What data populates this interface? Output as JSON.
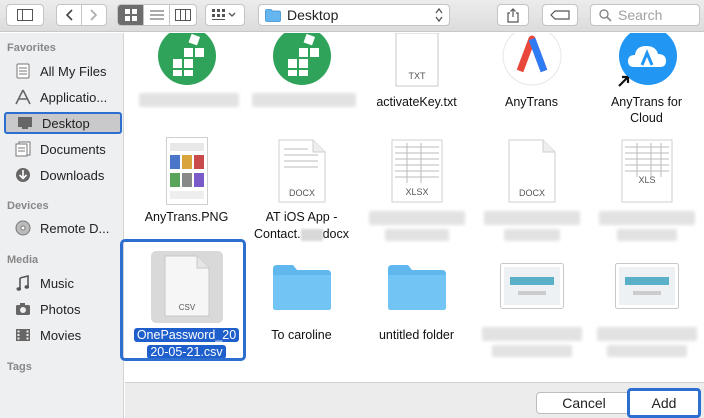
{
  "toolbar": {
    "location": "Desktop",
    "search_placeholder": "Search",
    "view_modes": [
      "icon-view",
      "list-view",
      "column-view"
    ],
    "active_view": "icon-view"
  },
  "sidebar": {
    "favorites_title": "Favorites",
    "favorites": [
      {
        "label": "All My Files",
        "icon": "all-files-icon"
      },
      {
        "label": "Applicatio...",
        "icon": "applications-icon"
      },
      {
        "label": "Desktop",
        "icon": "desktop-icon",
        "selected": true
      },
      {
        "label": "Documents",
        "icon": "documents-icon"
      },
      {
        "label": "Downloads",
        "icon": "downloads-icon"
      }
    ],
    "devices_title": "Devices",
    "devices": [
      {
        "label": "Remote D...",
        "icon": "remote-disc-icon"
      }
    ],
    "media_title": "Media",
    "media": [
      {
        "label": "Music",
        "icon": "music-icon"
      },
      {
        "label": "Photos",
        "icon": "photos-icon"
      },
      {
        "label": "Movies",
        "icon": "movies-icon"
      }
    ],
    "tags_title": "Tags"
  },
  "files": [
    {
      "name": "",
      "kind": "green-app"
    },
    {
      "name": "",
      "kind": "green-app"
    },
    {
      "name": "activateKey.txt",
      "kind": "txt",
      "badge": "TXT"
    },
    {
      "name": "AnyTrans",
      "kind": "anytrans-app"
    },
    {
      "name": "AnyTrans for Cloud",
      "name_line1": "AnyTrans for",
      "name_line2": "Cloud",
      "kind": "anytrans-cloud-alias"
    },
    {
      "name": "AnyTrans.PNG",
      "kind": "png"
    },
    {
      "name_line1": "AT iOS App -",
      "name_line2": "Contact.",
      "name_line2_end": "docx",
      "kind": "docx",
      "badge": "DOCX"
    },
    {
      "name": "",
      "kind": "xlsx",
      "badge": "XLSX"
    },
    {
      "name": "",
      "kind": "docx",
      "badge": "DOCX"
    },
    {
      "name": "",
      "kind": "xls",
      "badge": "XLS"
    },
    {
      "name_line1": "OnePassword_20",
      "name_line2": "20-05-21.csv",
      "kind": "csv",
      "badge": "CSV",
      "selected": true
    },
    {
      "name": "To caroline",
      "kind": "folder"
    },
    {
      "name": "untitled folder",
      "kind": "folder"
    },
    {
      "name": "",
      "kind": "screenshot"
    },
    {
      "name": "",
      "kind": "screenshot"
    }
  ],
  "buttons": {
    "cancel": "Cancel",
    "add": "Add"
  },
  "colors": {
    "selection_blue": "#2c6fd1",
    "folder_blue": "#5fb7ee",
    "app_green": "#2fa35a"
  }
}
